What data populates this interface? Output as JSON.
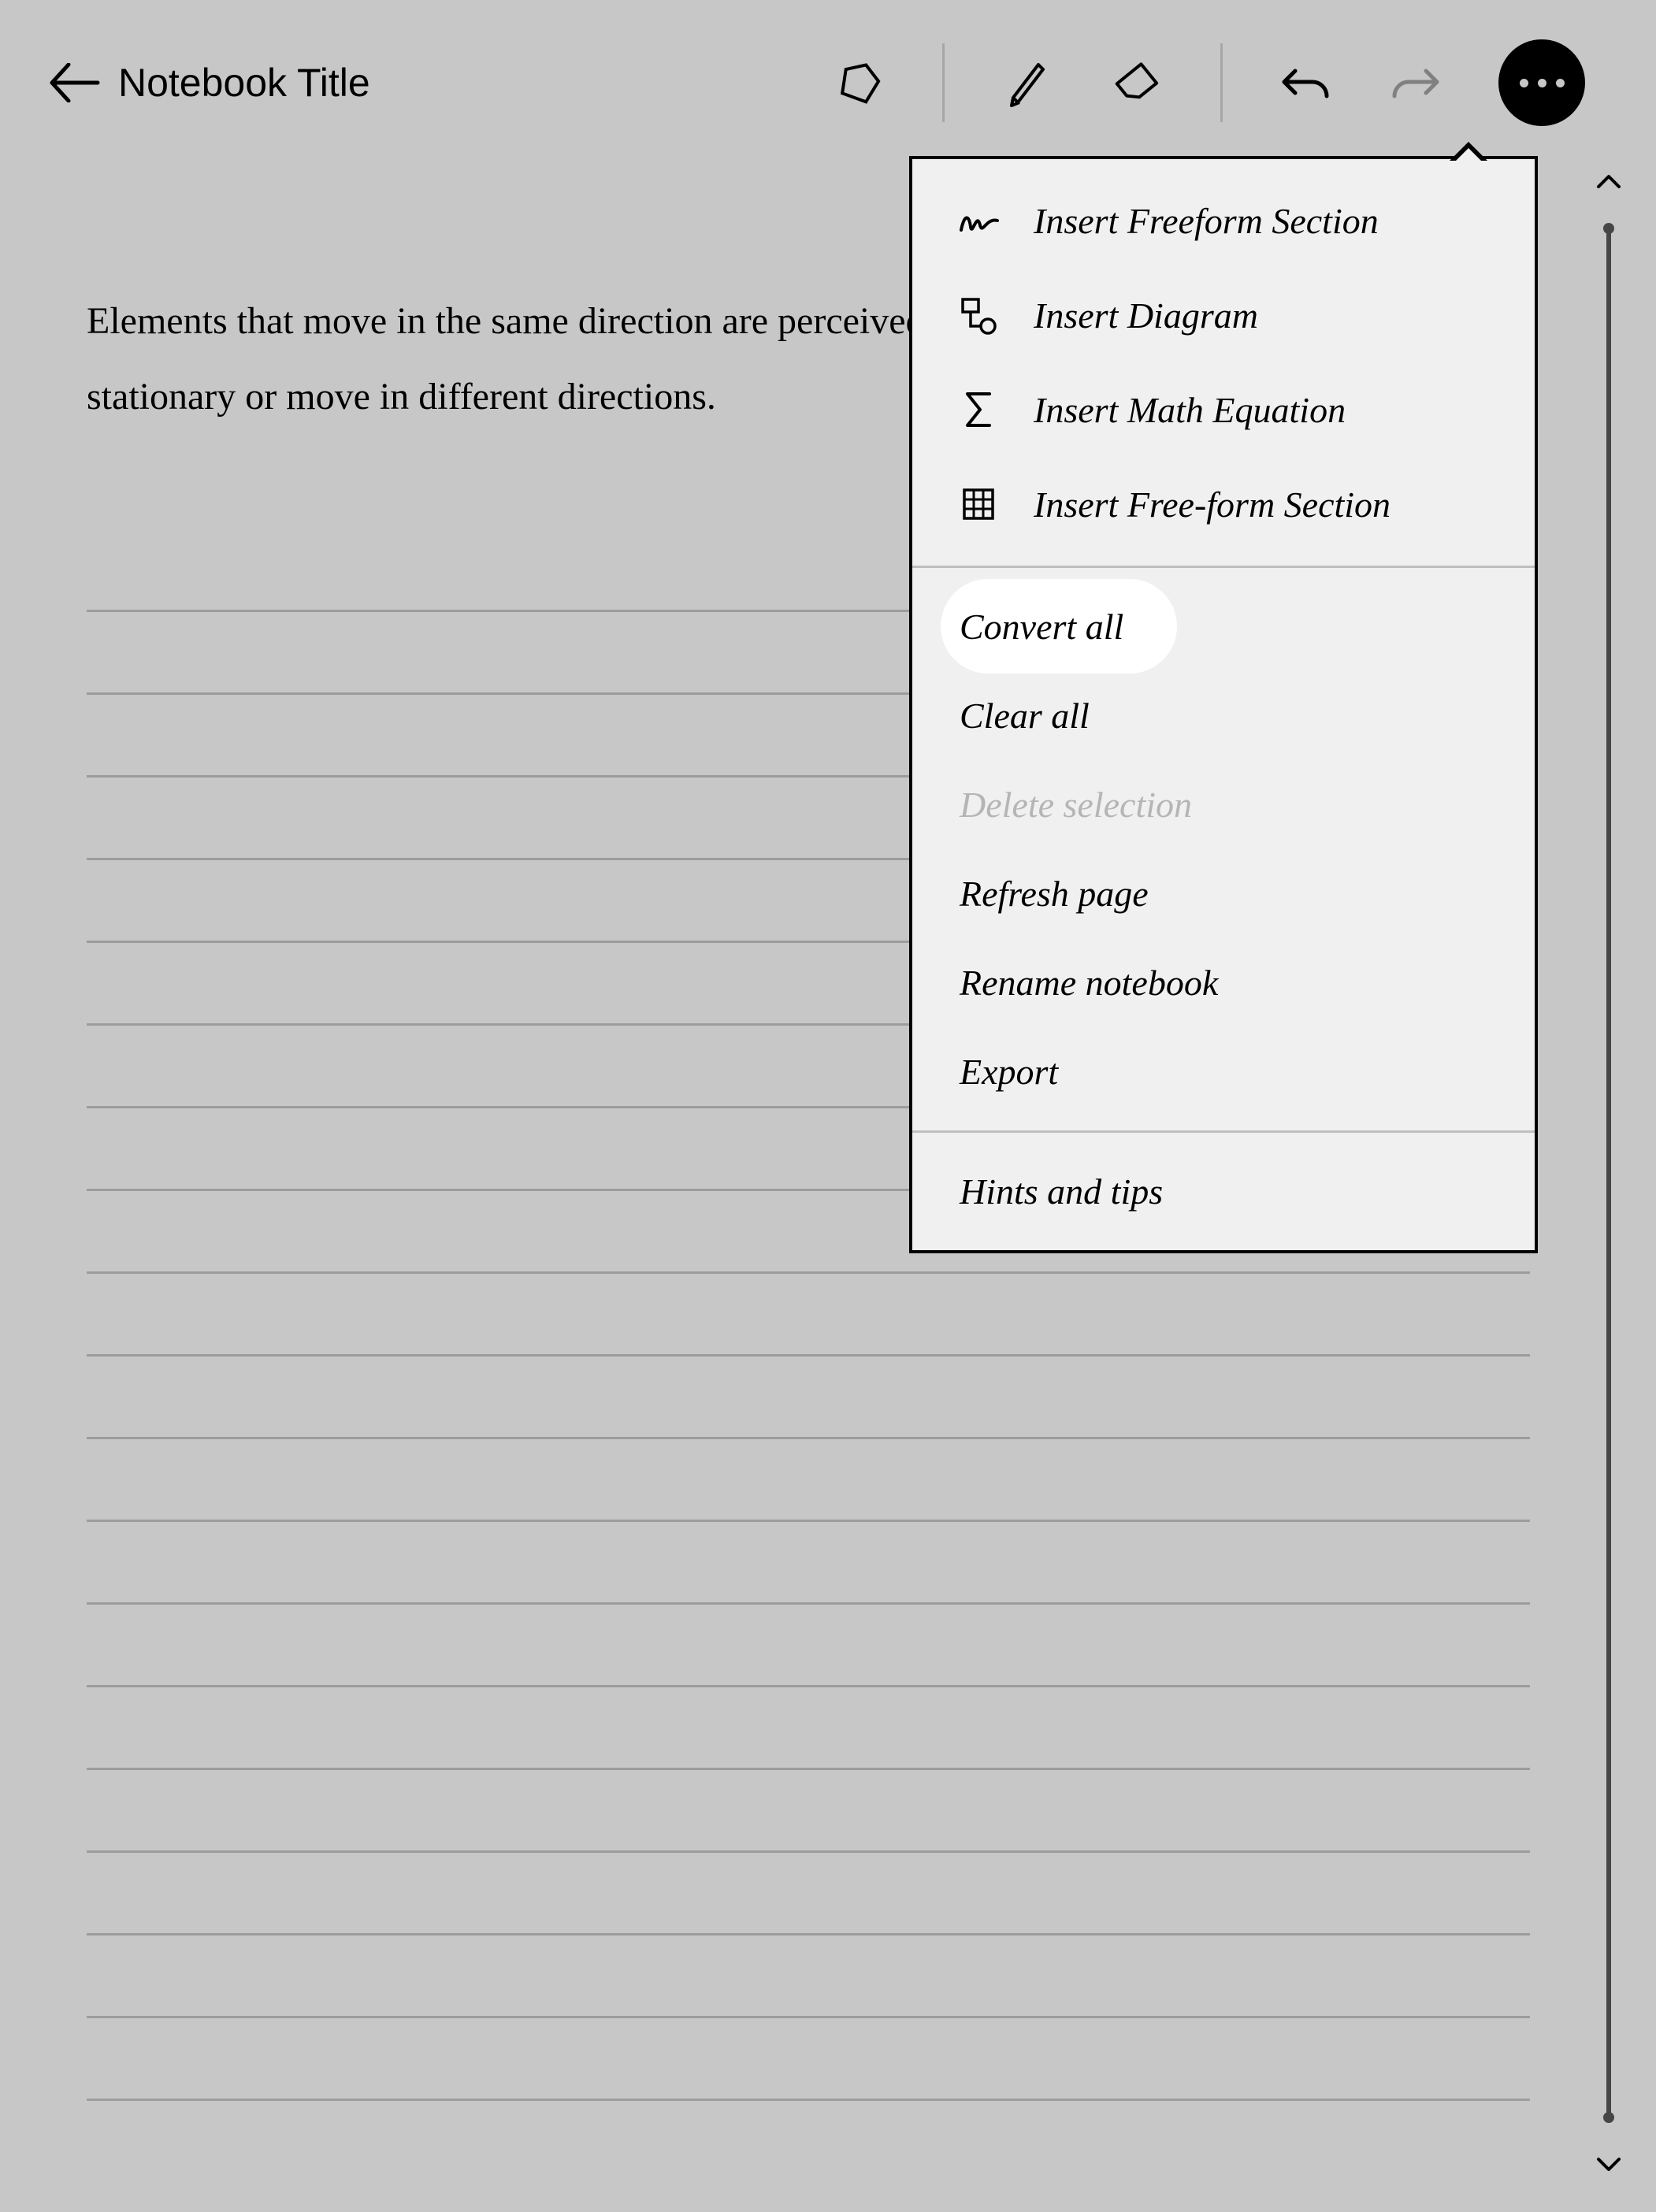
{
  "header": {
    "title": "Notebook Title"
  },
  "content": {
    "paragraph": "Elements that move in the same direction are perceived as more related than those that are stationary or move in different directions."
  },
  "menu": {
    "insert": [
      {
        "icon": "scribble-icon",
        "label": "Insert Freeform Section"
      },
      {
        "icon": "diagram-icon",
        "label": "Insert Diagram"
      },
      {
        "icon": "sigma-icon",
        "label": "Insert Math Equation"
      },
      {
        "icon": "grid-icon",
        "label": "Insert Free-form Section"
      }
    ],
    "actions": [
      {
        "label": "Convert all",
        "highlight": true
      },
      {
        "label": "Clear all"
      },
      {
        "label": "Delete selection",
        "disabled": true
      },
      {
        "label": "Refresh page"
      },
      {
        "label": "Rename notebook"
      },
      {
        "label": "Export"
      }
    ],
    "footer": [
      {
        "label": "Hints and tips"
      }
    ]
  }
}
